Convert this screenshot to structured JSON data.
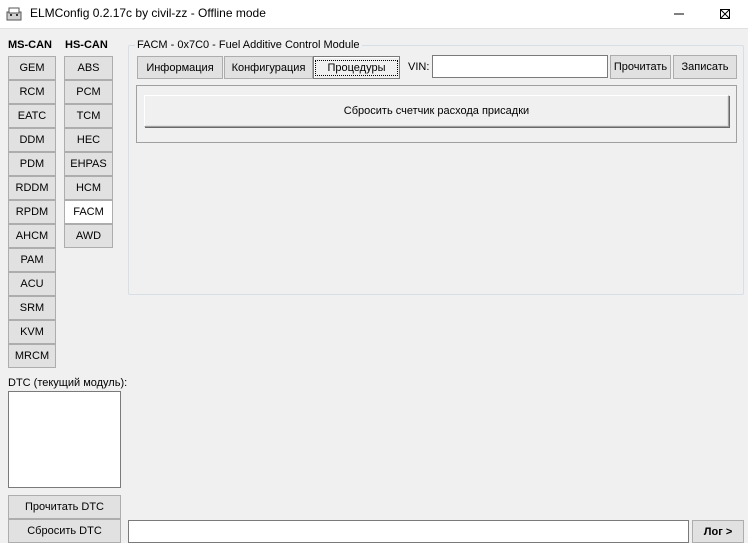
{
  "window": {
    "title": "ELMConfig 0.2.17c by civil-zz - Offline mode"
  },
  "ms_can": {
    "header": "MS-CAN",
    "modules": [
      "GEM",
      "RCM",
      "EATC",
      "DDM",
      "PDM",
      "RDDM",
      "RPDM",
      "AHCM",
      "PAM",
      "ACU",
      "SRM",
      "KVM",
      "MRCM"
    ]
  },
  "hs_can": {
    "header": "HS-CAN",
    "modules": [
      "ABS",
      "PCM",
      "TCM",
      "HEC",
      "EHPAS",
      "HCM",
      "FACM",
      "AWD"
    ],
    "selected": "FACM"
  },
  "module_group": {
    "title": "FACM - 0x7C0 - Fuel Additive Control Module"
  },
  "tabs": {
    "info": "Информация",
    "config": "Конфигурация",
    "procedures": "Процедуры"
  },
  "vin": {
    "label": "VIN:",
    "value": "",
    "read_button": "Прочитать",
    "write_button": "Записать"
  },
  "procedures": {
    "reset_additive_counter": "Сбросить счетчик расхода присадки"
  },
  "dtc": {
    "label": "DTC (текущий модуль):",
    "read_button": "Прочитать DTC",
    "reset_button": "Сбросить DTC"
  },
  "log": {
    "button": "Лог >",
    "value": ""
  }
}
